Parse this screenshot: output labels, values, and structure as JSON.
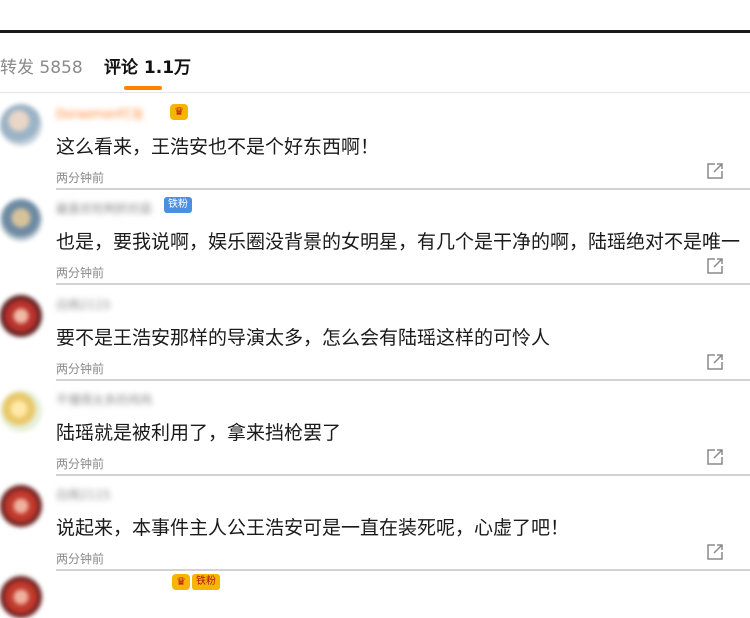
{
  "tabs": {
    "repost_label": "转发 5858",
    "comments_label": "评论 1.1万"
  },
  "colors": {
    "accent": "#ff8200",
    "fan_badge": "#4a90e2",
    "crown_badge": "#f7b500"
  },
  "comments": [
    {
      "username": "Doraemon叮当",
      "badge": "crown-icon",
      "text": "这么看来，王浩安也不是个好东西啊！",
      "time": "两分钟前"
    },
    {
      "username": "最喜欢吃鸭肝的菜",
      "badge": "铁粉",
      "text": "也是，要我说啊，娱乐圈没背景的女明星，有几个是干净的啊，陆瑶绝对不是唯一",
      "time": "两分钟前"
    },
    {
      "username": "白雨2115",
      "text": "要不是王浩安那样的导演太多，怎么会有陆瑶这样的可怜人",
      "time": "两分钟前"
    },
    {
      "username": "不懂得太多的鸡鸡",
      "text": "陆瑶就是被利用了，拿来挡枪罢了",
      "time": "两分钟前"
    },
    {
      "username": "白雨2115",
      "text": "说起来，本事件主人公王浩安可是一直在装死呢，心虚了吧！",
      "time": "两分钟前"
    }
  ],
  "next_comment": {
    "badge": "铁粉"
  }
}
